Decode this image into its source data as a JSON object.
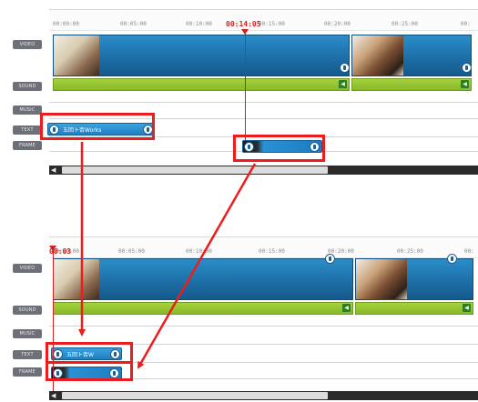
{
  "labels": {
    "video": "VIDEO",
    "sound": "SOUND",
    "music": "MUSIC",
    "text": "TEXT",
    "frame": "FRAME"
  },
  "top": {
    "ticks": [
      "00:00:00",
      "00:05:00",
      "00:10:00",
      "00:15:00",
      "00:20:00",
      "00:25:00",
      "00:"
    ],
    "playhead_time": "00:14:05",
    "text_clip_label": "五回ト否Works"
  },
  "bottom": {
    "ticks": [
      "00:00:00",
      "00:05:00",
      "00:10:00",
      "00:15:00",
      "00:20:00",
      "00:25:00",
      "00:"
    ],
    "playhead_time": "00:03",
    "text_clip_label": "五回ト否W"
  },
  "icons": {
    "speaker": "speaker-icon",
    "handle": "drag-handle-icon",
    "scroll_left": "arrow-left-icon"
  },
  "colors": {
    "highlight": "#ee1c1c",
    "playhead": "#d11f1f",
    "video_clip": "#1e6fa8",
    "sound_clip": "#86b92a"
  }
}
